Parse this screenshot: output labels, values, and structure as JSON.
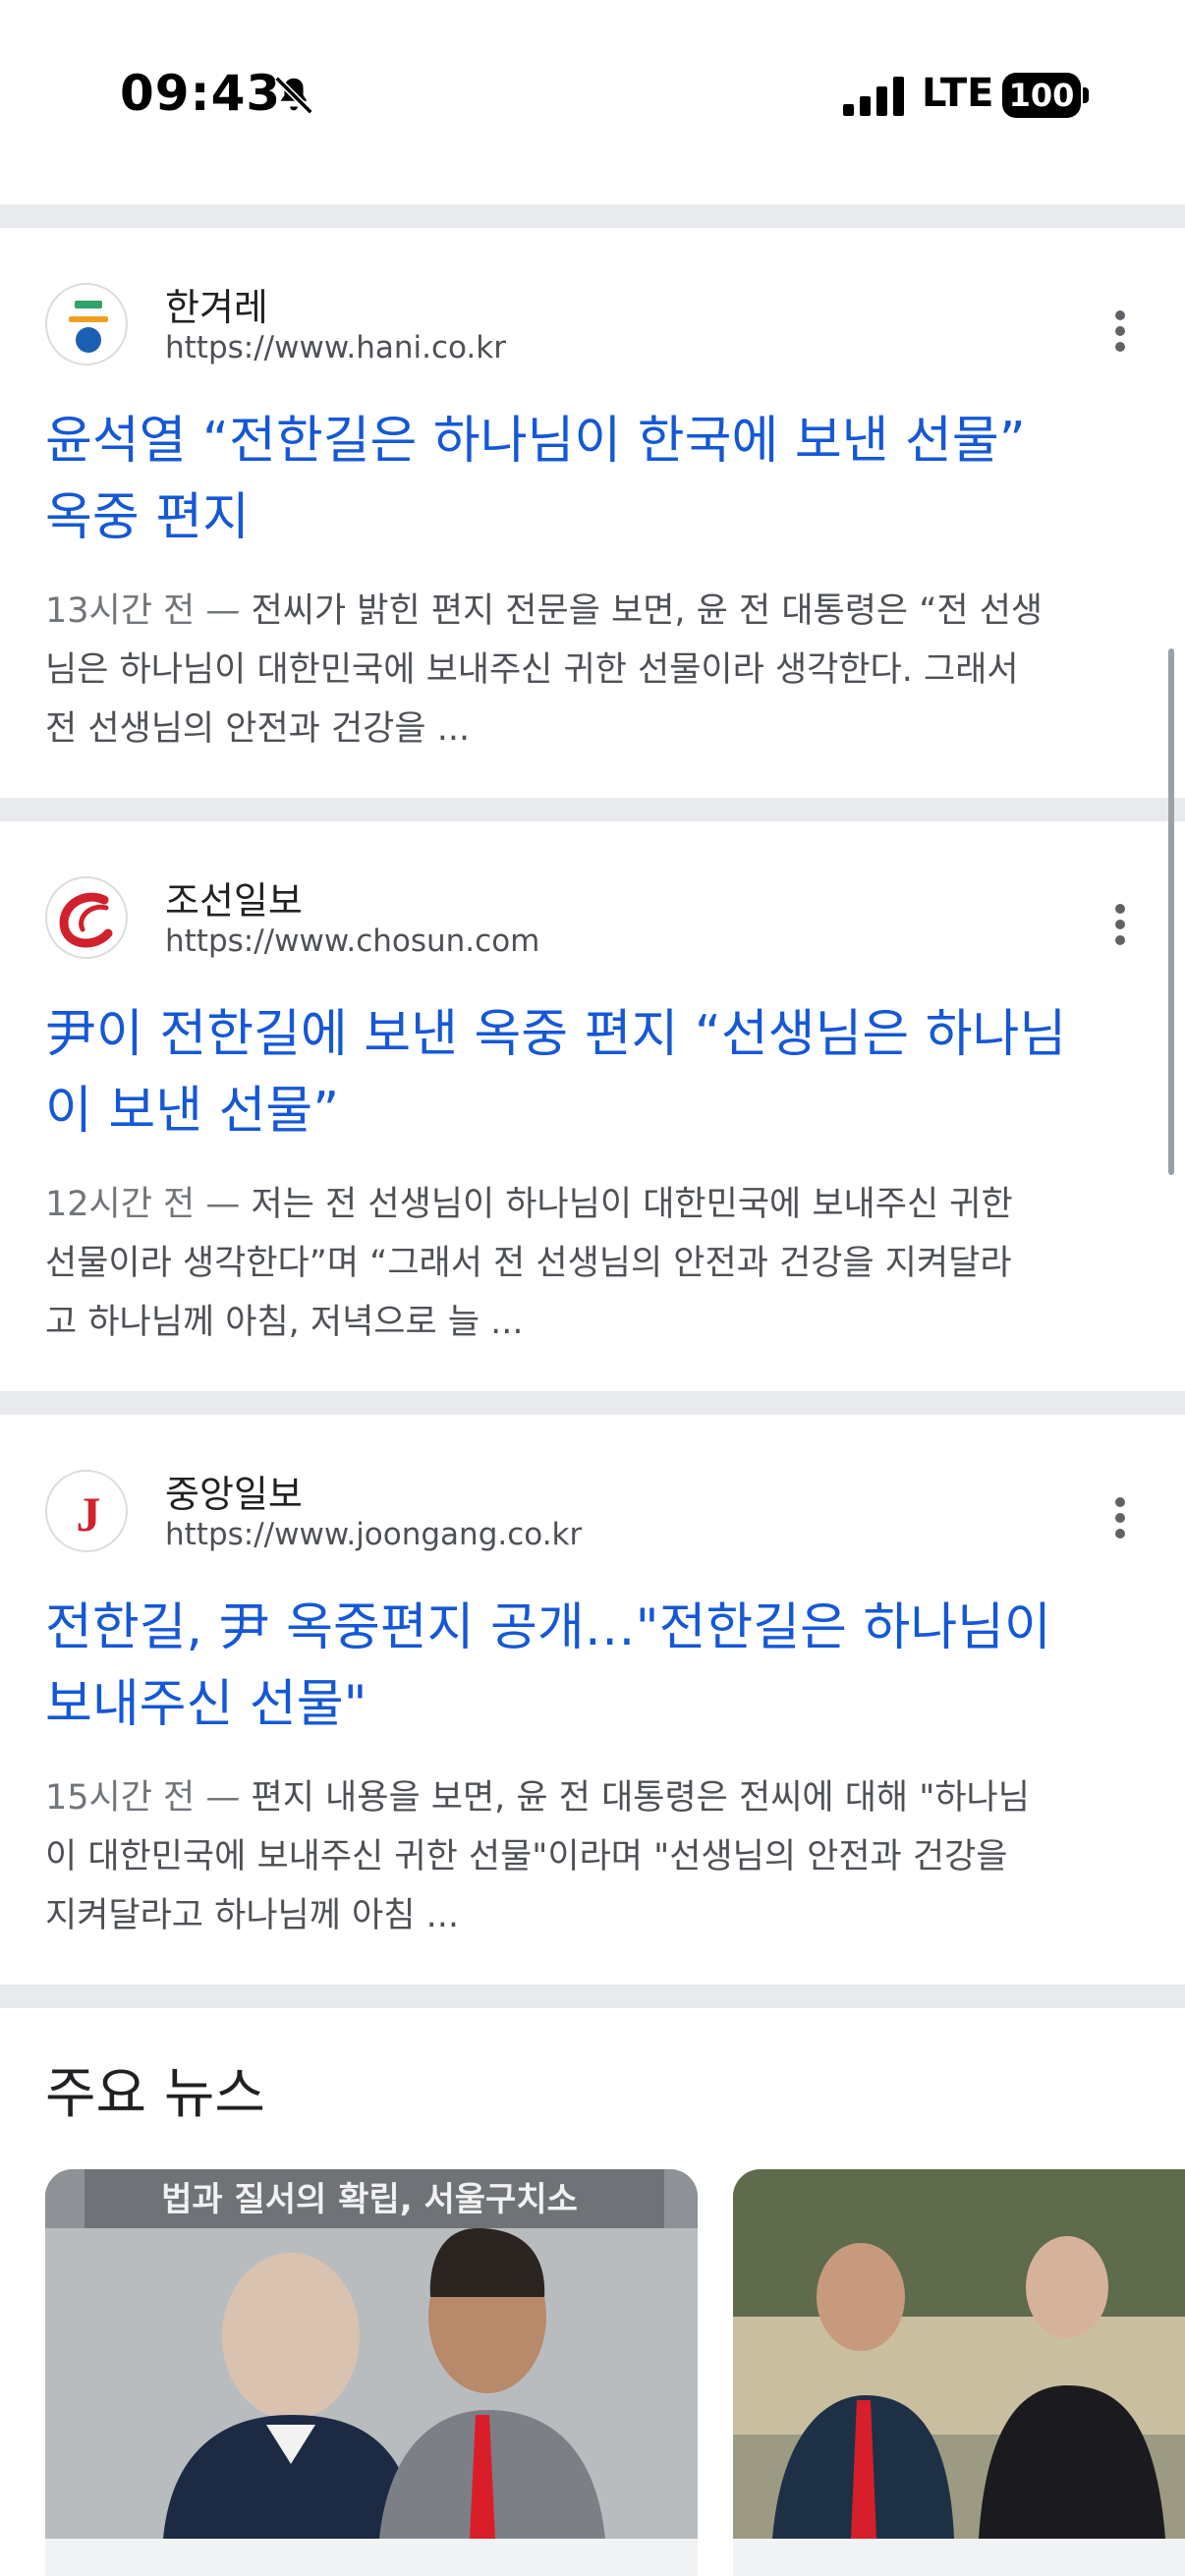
{
  "status_bar": {
    "time": "09:43",
    "network": "LTE",
    "battery": "100"
  },
  "results": [
    {
      "source_name": "한겨레",
      "url": "https://www.hani.co.kr",
      "title_line1": "윤석열 “전한길은 하나님이 한국에 보낸 선물”",
      "title_line2": "옥중 편지",
      "snippet_date": "13시간 전 — ",
      "snippet_line1": "전씨가 밝힌 편지 전문을 보면, 윤 전 대통령은 “전 선생",
      "snippet_line2": "님은 하나님이 대한민국에 보내주신 귀한 선물이라 생각한다. 그래서",
      "snippet_line3": "전 선생님의 안전과 건강을 ..."
    },
    {
      "source_name": "조선일보",
      "url": "https://www.chosun.com",
      "title_line1": "尹이 전한길에 보낸 옥중 편지 “선생님은 하나님",
      "title_line2": "이 보낸 선물”",
      "snippet_date": "12시간 전 — ",
      "snippet_line1": "저는 전 선생님이 하나님이 대한민국에 보내주신 귀한",
      "snippet_line2": "선물이라 생각한다”며 “그래서 전 선생님의 안전과 건강을 지켜달라",
      "snippet_line3": "고 하나님께 아침, 저녁으로 늘 ..."
    },
    {
      "source_name": "중앙일보",
      "url": "https://www.joongang.co.kr",
      "title_line1": "전한길, 尹 옥중편지 공개…\"전한길은 하나님이",
      "title_line2": "보내주신 선물\"",
      "snippet_date": "15시간 전 — ",
      "snippet_line1": "편지 내용을 보면, 윤 전 대통령은 전씨에 대해 \"하나님",
      "snippet_line2": "이 대한민국에 보내주신 귀한 선물\"이라며 \"선생님의 안전과 건강을",
      "snippet_line3": "지켜달라고 하나님께 아침 ..."
    }
  ],
  "top_news": {
    "title": "주요 뉴스",
    "card1_sign": "법과 질서의 확립, 서울구치소"
  },
  "colors": {
    "link": "#1558d6",
    "separator": "#e8eaed"
  }
}
